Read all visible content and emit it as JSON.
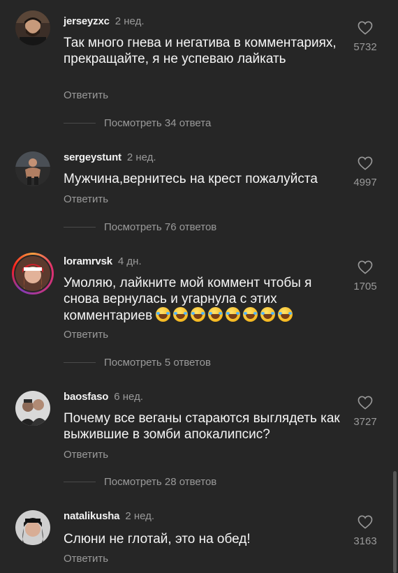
{
  "comments": [
    {
      "username": "jerseyzxc",
      "time": "2 нед.",
      "text": "Так много гнева и негатива в комментариях, прекращайте, я не успеваю лайкать",
      "reply_label": "Ответить",
      "likes": "5732",
      "view_replies": "Посмотреть 34 ответа"
    },
    {
      "username": "sergeystunt",
      "time": "2 нед.",
      "text": "Мужчина,вернитесь на крест пожалуйста",
      "reply_label": "Ответить",
      "likes": "4997",
      "view_replies": "Посмотреть 76 ответов"
    },
    {
      "username": "loramrvsk",
      "time": "4 дн.",
      "text": "Умоляю, лайкните мой коммент чтобы я снова вернулась и угарнула с этих комментариев",
      "emoji": "😂😂😂😂😂😂😂😂",
      "reply_label": "Ответить",
      "likes": "1705",
      "view_replies": "Посмотреть 5 ответов"
    },
    {
      "username": "baosfaso",
      "time": "6 нед.",
      "text": "Почему все веганы стараются выглядеть как выжившие в зомби апокалипсис?",
      "reply_label": "Ответить",
      "likes": "3727",
      "view_replies": "Посмотреть 28 ответов"
    },
    {
      "username": "natalikusha",
      "time": "2 нед.",
      "text": "Слюни не глотай, это на обед!",
      "reply_label": "Ответить",
      "likes": "3163"
    }
  ],
  "icons": {
    "like": "heart-outline-icon"
  },
  "colors": {
    "background": "#262626",
    "text_primary": "#f5f5f5",
    "text_secondary": "#9a9a9a"
  }
}
